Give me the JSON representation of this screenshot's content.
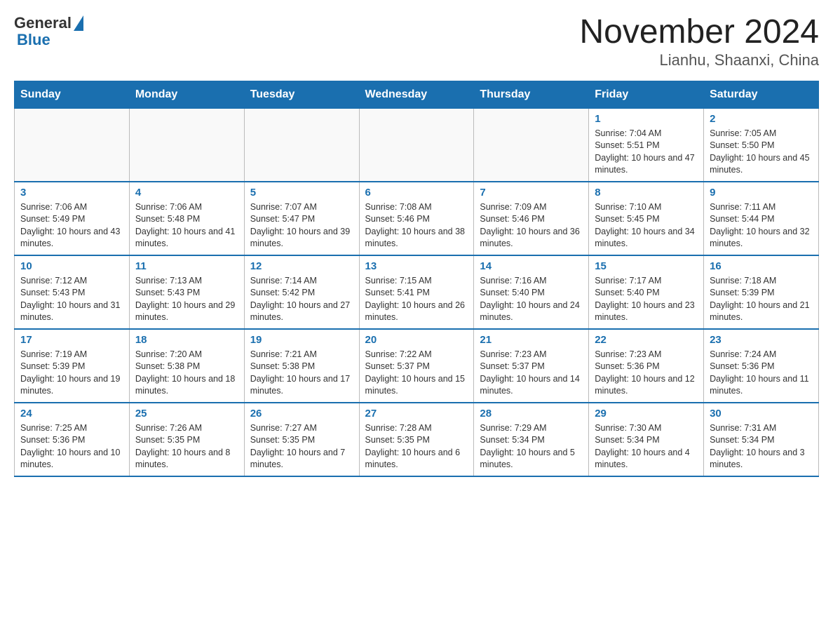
{
  "logo": {
    "general": "General",
    "blue": "Blue"
  },
  "title": "November 2024",
  "subtitle": "Lianhu, Shaanxi, China",
  "days_of_week": [
    "Sunday",
    "Monday",
    "Tuesday",
    "Wednesday",
    "Thursday",
    "Friday",
    "Saturday"
  ],
  "weeks": [
    {
      "days": [
        {
          "num": "",
          "info": ""
        },
        {
          "num": "",
          "info": ""
        },
        {
          "num": "",
          "info": ""
        },
        {
          "num": "",
          "info": ""
        },
        {
          "num": "",
          "info": ""
        },
        {
          "num": "1",
          "info": "Sunrise: 7:04 AM\nSunset: 5:51 PM\nDaylight: 10 hours and 47 minutes."
        },
        {
          "num": "2",
          "info": "Sunrise: 7:05 AM\nSunset: 5:50 PM\nDaylight: 10 hours and 45 minutes."
        }
      ]
    },
    {
      "days": [
        {
          "num": "3",
          "info": "Sunrise: 7:06 AM\nSunset: 5:49 PM\nDaylight: 10 hours and 43 minutes."
        },
        {
          "num": "4",
          "info": "Sunrise: 7:06 AM\nSunset: 5:48 PM\nDaylight: 10 hours and 41 minutes."
        },
        {
          "num": "5",
          "info": "Sunrise: 7:07 AM\nSunset: 5:47 PM\nDaylight: 10 hours and 39 minutes."
        },
        {
          "num": "6",
          "info": "Sunrise: 7:08 AM\nSunset: 5:46 PM\nDaylight: 10 hours and 38 minutes."
        },
        {
          "num": "7",
          "info": "Sunrise: 7:09 AM\nSunset: 5:46 PM\nDaylight: 10 hours and 36 minutes."
        },
        {
          "num": "8",
          "info": "Sunrise: 7:10 AM\nSunset: 5:45 PM\nDaylight: 10 hours and 34 minutes."
        },
        {
          "num": "9",
          "info": "Sunrise: 7:11 AM\nSunset: 5:44 PM\nDaylight: 10 hours and 32 minutes."
        }
      ]
    },
    {
      "days": [
        {
          "num": "10",
          "info": "Sunrise: 7:12 AM\nSunset: 5:43 PM\nDaylight: 10 hours and 31 minutes."
        },
        {
          "num": "11",
          "info": "Sunrise: 7:13 AM\nSunset: 5:43 PM\nDaylight: 10 hours and 29 minutes."
        },
        {
          "num": "12",
          "info": "Sunrise: 7:14 AM\nSunset: 5:42 PM\nDaylight: 10 hours and 27 minutes."
        },
        {
          "num": "13",
          "info": "Sunrise: 7:15 AM\nSunset: 5:41 PM\nDaylight: 10 hours and 26 minutes."
        },
        {
          "num": "14",
          "info": "Sunrise: 7:16 AM\nSunset: 5:40 PM\nDaylight: 10 hours and 24 minutes."
        },
        {
          "num": "15",
          "info": "Sunrise: 7:17 AM\nSunset: 5:40 PM\nDaylight: 10 hours and 23 minutes."
        },
        {
          "num": "16",
          "info": "Sunrise: 7:18 AM\nSunset: 5:39 PM\nDaylight: 10 hours and 21 minutes."
        }
      ]
    },
    {
      "days": [
        {
          "num": "17",
          "info": "Sunrise: 7:19 AM\nSunset: 5:39 PM\nDaylight: 10 hours and 19 minutes."
        },
        {
          "num": "18",
          "info": "Sunrise: 7:20 AM\nSunset: 5:38 PM\nDaylight: 10 hours and 18 minutes."
        },
        {
          "num": "19",
          "info": "Sunrise: 7:21 AM\nSunset: 5:38 PM\nDaylight: 10 hours and 17 minutes."
        },
        {
          "num": "20",
          "info": "Sunrise: 7:22 AM\nSunset: 5:37 PM\nDaylight: 10 hours and 15 minutes."
        },
        {
          "num": "21",
          "info": "Sunrise: 7:23 AM\nSunset: 5:37 PM\nDaylight: 10 hours and 14 minutes."
        },
        {
          "num": "22",
          "info": "Sunrise: 7:23 AM\nSunset: 5:36 PM\nDaylight: 10 hours and 12 minutes."
        },
        {
          "num": "23",
          "info": "Sunrise: 7:24 AM\nSunset: 5:36 PM\nDaylight: 10 hours and 11 minutes."
        }
      ]
    },
    {
      "days": [
        {
          "num": "24",
          "info": "Sunrise: 7:25 AM\nSunset: 5:36 PM\nDaylight: 10 hours and 10 minutes."
        },
        {
          "num": "25",
          "info": "Sunrise: 7:26 AM\nSunset: 5:35 PM\nDaylight: 10 hours and 8 minutes."
        },
        {
          "num": "26",
          "info": "Sunrise: 7:27 AM\nSunset: 5:35 PM\nDaylight: 10 hours and 7 minutes."
        },
        {
          "num": "27",
          "info": "Sunrise: 7:28 AM\nSunset: 5:35 PM\nDaylight: 10 hours and 6 minutes."
        },
        {
          "num": "28",
          "info": "Sunrise: 7:29 AM\nSunset: 5:34 PM\nDaylight: 10 hours and 5 minutes."
        },
        {
          "num": "29",
          "info": "Sunrise: 7:30 AM\nSunset: 5:34 PM\nDaylight: 10 hours and 4 minutes."
        },
        {
          "num": "30",
          "info": "Sunrise: 7:31 AM\nSunset: 5:34 PM\nDaylight: 10 hours and 3 minutes."
        }
      ]
    }
  ]
}
